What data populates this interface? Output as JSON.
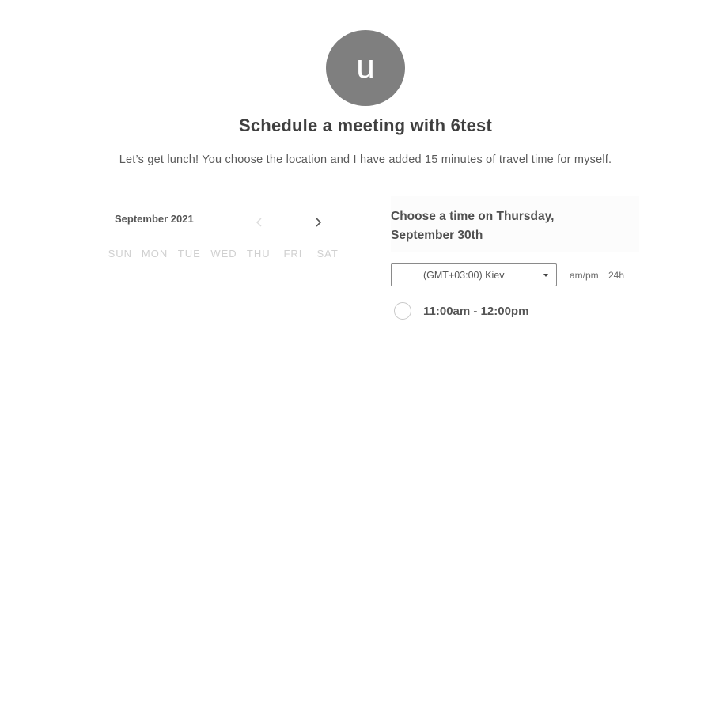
{
  "avatar": {
    "initial": "u"
  },
  "header": {
    "title": "Schedule a meeting with 6test",
    "description": "Let’s get lunch! You choose the location and I have added 15 minutes of travel time for myself."
  },
  "calendar": {
    "month_label": "September 2021",
    "prev_icon": "chevron-left-icon",
    "next_icon": "chevron-right-icon",
    "weekdays": [
      "SUN",
      "MON",
      "TUE",
      "WED",
      "THU",
      "FRI",
      "SAT"
    ]
  },
  "times": {
    "heading": "Choose a time on Thursday, September 30th",
    "timezone": {
      "selected": "(GMT+03:00) Kiev"
    },
    "format_ampm": "am/pm",
    "format_24h": "24h",
    "slots": [
      {
        "label": "11:00am - 12:00pm"
      }
    ]
  },
  "colors": {
    "avatar_bg": "#7f7f7f",
    "weekday_text": "#d0d0d0",
    "text_dark": "#4a4a4a"
  }
}
